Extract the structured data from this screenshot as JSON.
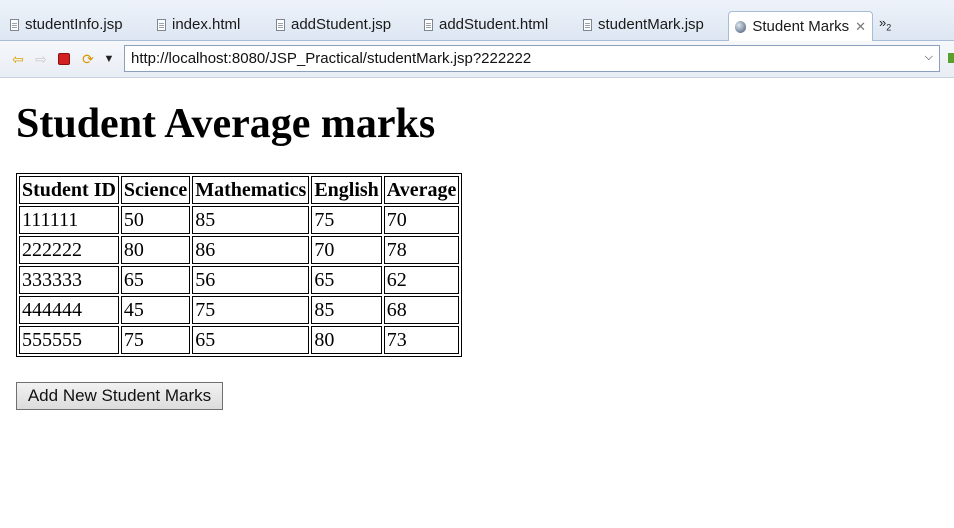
{
  "tabs": [
    {
      "label": "studentInfo.jsp",
      "icon": "document-icon"
    },
    {
      "label": "index.html",
      "icon": "document-icon"
    },
    {
      "label": "addStudent.jsp",
      "icon": "document-icon"
    },
    {
      "label": "addStudent.html",
      "icon": "document-icon"
    },
    {
      "label": "studentMark.jsp",
      "icon": "document-icon"
    },
    {
      "label": "Student Marks",
      "icon": "globe-icon",
      "active": true
    }
  ],
  "tab_overflow": {
    "symbol": "»",
    "count": "2"
  },
  "toolbar": {
    "url": "http://localhost:8080/JSP_Practical/studentMark.jsp?222222"
  },
  "page": {
    "heading": "Student Average marks",
    "table": {
      "headers": [
        "Student ID",
        "Science",
        "Mathematics",
        "English",
        "Average"
      ],
      "rows": [
        [
          "111111",
          "50",
          "85",
          "75",
          "70"
        ],
        [
          "222222",
          "80",
          "86",
          "70",
          "78"
        ],
        [
          "333333",
          "65",
          "56",
          "65",
          "62"
        ],
        [
          "444444",
          "45",
          "75",
          "85",
          "68"
        ],
        [
          "555555",
          "75",
          "65",
          "80",
          "73"
        ]
      ]
    },
    "add_button_label": "Add New Student Marks"
  },
  "colors": {
    "stop": "#d42020",
    "nav_arrow": "#d9a400",
    "tab_border": "#a9bcd6"
  }
}
